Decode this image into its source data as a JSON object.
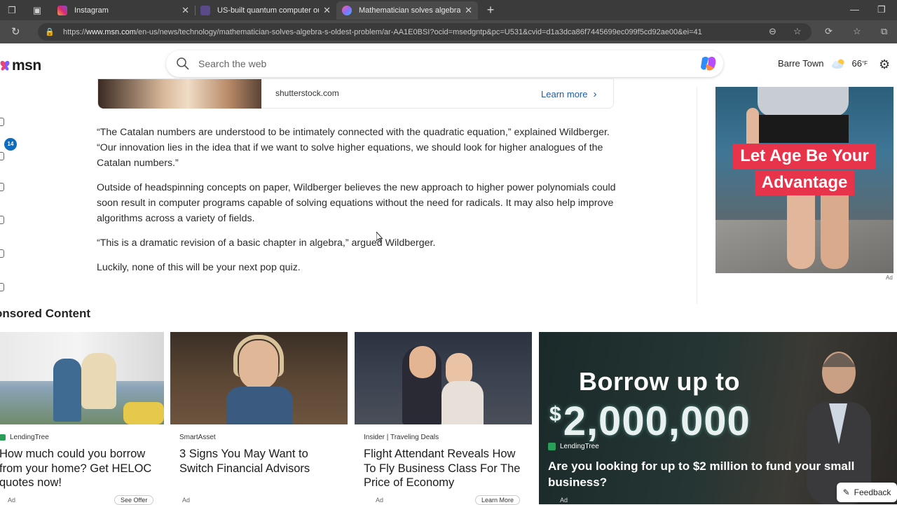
{
  "browser": {
    "tabs": [
      {
        "label": "Instagram",
        "active": false,
        "favicon_color": "#d62976"
      },
      {
        "label": "US-built quantum computer outs",
        "active": false,
        "favicon_color": "#5a4a8a"
      },
      {
        "label": "Mathematician solves algebra's o",
        "active": true,
        "favicon_color": "#8c6cff"
      }
    ],
    "url_prefix": "https://",
    "url_host": "www.msn.com",
    "url_path": "/en-us/news/technology/mathematician-solves-algebra-s-oldest-problem/ar-AA1E0BSI?ocid=msedgntp&pc=U531&cvid=d1a3dca86f7445699ec099f5cd92ae00&ei=41"
  },
  "header": {
    "logo_text": "msn",
    "search_placeholder": "Search the web",
    "location": "Barre Town",
    "temperature": "66",
    "temp_unit": "°F"
  },
  "rail": {
    "badge": "14"
  },
  "top_ad": {
    "domain": "shutterstock.com",
    "cta": "Learn more"
  },
  "article": {
    "paragraphs": [
      "“The Catalan numbers are understood to be intimately connected with the quadratic equation,” explained Wildberger. “Our innovation lies in the idea that if we want to solve higher equations, we should look for higher analogues of the Catalan numbers.”",
      "Outside of headspinning concepts on paper, Wildberger believes the new approach to higher power polynomials could soon result in computer programs capable of solving equations without the need for radicals. It may also help improve algorithms across a variety of fields.",
      "“This is a dramatic revision of a basic chapter in algebra,” argued Wildberger.",
      "Luckily, none of this will be your next pop quiz."
    ]
  },
  "right_ad": {
    "line1": "Let Age Be Your",
    "line2": "Advantage",
    "tag": "Ad"
  },
  "sponsored": {
    "title": "onsored Content",
    "cards": [
      {
        "source": "LendingTree",
        "title": "How much could you borrow from your home? Get HELOC quotes now!",
        "ad": "Ad",
        "button": "See Offer"
      },
      {
        "source": "SmartAsset",
        "title": "3 Signs You May Want to Switch Financial Advisors",
        "ad": "Ad",
        "button": ""
      },
      {
        "source": "Insider | Traveling Deals",
        "title": "Flight Attendant Reveals How To Fly Business Class For The Price of Economy",
        "ad": "Ad",
        "button": "Learn More"
      }
    ],
    "big_card": {
      "headline1": "Borrow up to",
      "currency": "$",
      "amount": "2,000,000",
      "source": "LendingTree",
      "title": "Are you looking for up to $2 million to fund your small business?",
      "ad": "Ad"
    }
  },
  "feedback_label": "Feedback",
  "colors": {
    "accent": "#0f6cbd",
    "link": "#1f5aa6",
    "ad_red": "#e8344a"
  }
}
